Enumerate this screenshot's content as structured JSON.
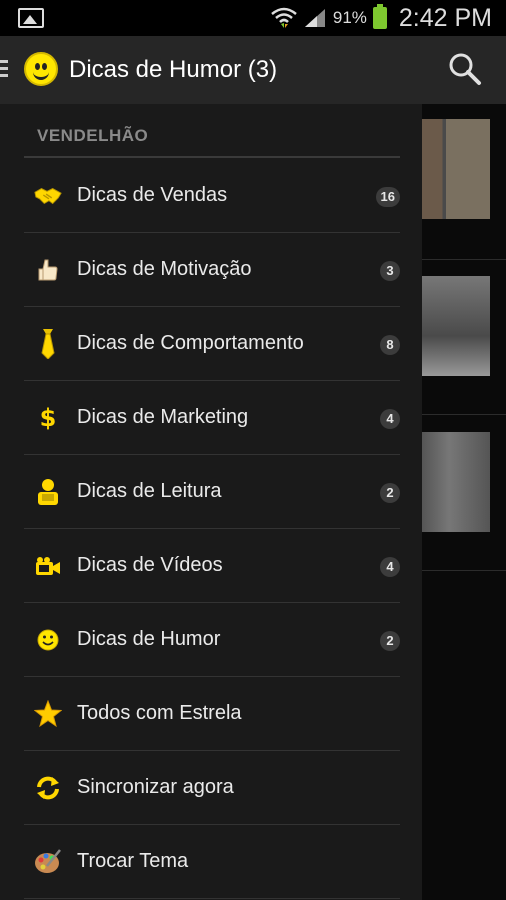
{
  "status_bar": {
    "battery": "91%",
    "time": "2:42 PM"
  },
  "action_bar": {
    "title": "Dicas de Humor (3)"
  },
  "drawer": {
    "section": "VENDELHÃO",
    "items": [
      {
        "label": "Dicas de Vendas",
        "count": "16",
        "icon": "handshake-icon"
      },
      {
        "label": "Dicas de Motivação",
        "count": "3",
        "icon": "thumbs-up-icon"
      },
      {
        "label": "Dicas de Comportamento",
        "count": "8",
        "icon": "tie-icon"
      },
      {
        "label": "Dicas de Marketing",
        "count": "4",
        "icon": "dollar-icon"
      },
      {
        "label": "Dicas de Leitura",
        "count": "2",
        "icon": "reader-icon"
      },
      {
        "label": "Dicas de Vídeos",
        "count": "4",
        "icon": "video-camera-icon"
      },
      {
        "label": "Dicas de Humor",
        "count": "2",
        "icon": "smiley-icon"
      },
      {
        "label": "Todos com Estrela",
        "icon": "star-icon"
      },
      {
        "label": "Sincronizar agora",
        "icon": "sync-icon"
      },
      {
        "label": "Trocar Tema",
        "icon": "palette-icon"
      }
    ]
  },
  "colors": {
    "accent": "#ffe600",
    "drawer_bg": "#1a1a1a",
    "actionbar_bg": "#262626",
    "battery": "#7ec82f"
  }
}
